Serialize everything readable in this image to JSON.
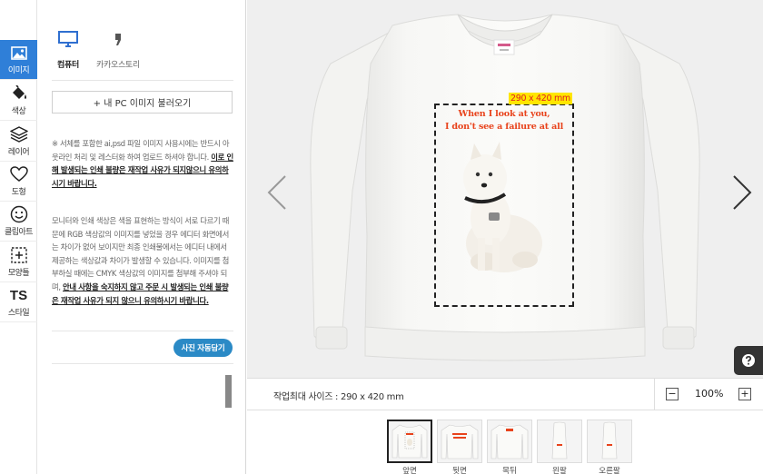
{
  "rail": {
    "items": [
      {
        "label": "이미지",
        "icon": "image-icon",
        "active": true
      },
      {
        "label": "색상",
        "icon": "paint-bucket-icon"
      },
      {
        "label": "레이어",
        "icon": "layers-icon"
      },
      {
        "label": "도형",
        "icon": "heart-shape-icon"
      },
      {
        "label": "클립아트",
        "icon": "smiley-icon"
      },
      {
        "label": "모양틀",
        "icon": "frame-icon"
      },
      {
        "label": "스타일",
        "icon": "text-style-icon",
        "glyph": "TS"
      }
    ]
  },
  "panel": {
    "tabs": [
      {
        "label": "컴퓨터",
        "icon": "monitor-icon",
        "active": true
      },
      {
        "label": "카카오스토리",
        "icon": "kakaostory-icon"
      }
    ],
    "upload_label": "+ 내 PC 이미지 불러오기",
    "note1_plain": "※ 서체를 포함한 ai,psd 파일 이미지 사용시에는 반드시 아웃라인 처리 및 레스터화 하여 업로드 하셔야 합니다. ",
    "note1_underline": "이로 인해 발생되는 인쇄 불량은 재작업 사유가 되지않으니 유의하시기 바랍니다.",
    "note2_plain": "모니터와 인쇄 색상은 색을 표현하는 방식이 서로 다르기 때문에 RGB 색상값의 이미지를 넣었을 경우 에디터 화면에서는 차이가 없어 보이지만 최종 인쇄물에서는 에디터 내에서 제공하는 색상값과 차이가 발생할 수 있습니다. 이미지를 첨부하실 때에는 CMYK 색상값의 이미지를 첨부해 주셔야 되며, ",
    "note2_underline": "안내 사항을 숙지하지 않고 주문 시 발생되는 인쇄 불량은 재작업 사유가 되지 않으니 유의하시기 바랍니다.",
    "auto_button": "사진 자동담기"
  },
  "stage": {
    "size_tag": "290 x 420 mm",
    "print_line1": "When I look at you,",
    "print_line2": "I don't see a failure at all",
    "colors": {
      "accent": "#2f7fd8",
      "print_text": "#e8431c",
      "size_tag_bg": "#ffe600",
      "size_tag_text": "#e02020",
      "stage_bg": "#efefef"
    }
  },
  "infobar": {
    "max_size_label": "작업최대 사이즈 : 290 x 420 mm",
    "zoom_minus": "−",
    "zoom_value": "100%",
    "zoom_plus": "+"
  },
  "views": [
    {
      "label": "앞면",
      "active": true
    },
    {
      "label": "뒷면"
    },
    {
      "label": "목뒤"
    },
    {
      "label": "왼팔"
    },
    {
      "label": "오른팔"
    }
  ]
}
